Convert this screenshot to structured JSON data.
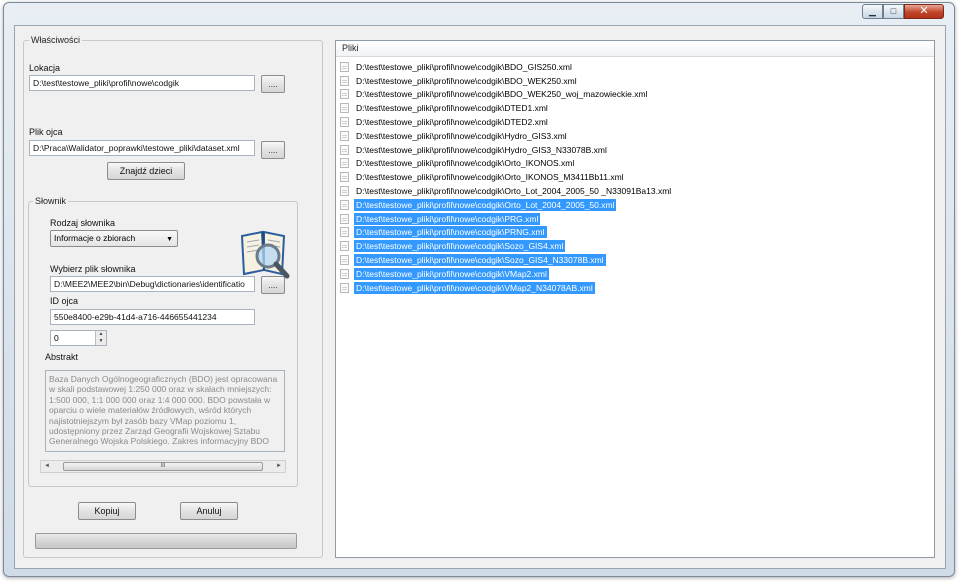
{
  "window": {
    "buttons": {
      "minimize": "▁",
      "maximize": "□",
      "close": "✕"
    }
  },
  "properties": {
    "title": "Właściwości",
    "location": {
      "label": "Lokacja",
      "value": "D:\\test\\testowe_pliki\\profil\\nowe\\codgik",
      "browse": "...."
    },
    "parent_file": {
      "label": "Plik ojca",
      "value": "D:\\Praca\\Walidator_poprawki\\testowe_pliki\\dataset.xml",
      "browse": "...."
    },
    "find_children": "Znajdź dzieci",
    "dictionary": {
      "title": "Słownik",
      "type_label": "Rodzaj słownika",
      "type_value": "Informacje o zbiorach",
      "file_label": "Wybierz plik słownika",
      "file_value": "D:\\MEE2\\MEE2\\bin\\Debug\\dictionaries\\identificatio",
      "browse": "....",
      "id_label": "ID ojca",
      "id_value": "550e8400-e29b-41d4-a716-446655441234",
      "spinner_value": "0",
      "abstract_label": "Abstrakt",
      "abstract_text": "Baza Danych Ogólnogeograficznych (BDO) jest opracowana w skali podstawowej 1:250 000 oraz w skalach mniejszych: 1:500 000, 1:1 000 000 oraz 1:4 000 000. BDO powstała w oparciu o wiele materiałów źródłowych, wśród których najistotniejszym był zasób bazy VMap poziomu 1, udostępniony przez Zarząd Geografii Wojskowej Sztabu Generalnego Wojska Polskiego. Zakres informacyjny BDO",
      "scroll_thumb": "III"
    },
    "copy": "Kopiuj",
    "cancel": "Anuluj",
    "progress": 0
  },
  "files": {
    "header": "Pliki",
    "items": [
      {
        "path": "D:\\test\\testowe_pliki\\profil\\nowe\\codgik\\BDO_GIS250.xml",
        "selected": false
      },
      {
        "path": "D:\\test\\testowe_pliki\\profil\\nowe\\codgik\\BDO_WEK250.xml",
        "selected": false
      },
      {
        "path": "D:\\test\\testowe_pliki\\profil\\nowe\\codgik\\BDO_WEK250_woj_mazowieckie.xml",
        "selected": false
      },
      {
        "path": "D:\\test\\testowe_pliki\\profil\\nowe\\codgik\\DTED1.xml",
        "selected": false
      },
      {
        "path": "D:\\test\\testowe_pliki\\profil\\nowe\\codgik\\DTED2.xml",
        "selected": false
      },
      {
        "path": "D:\\test\\testowe_pliki\\profil\\nowe\\codgik\\Hydro_GIS3.xml",
        "selected": false
      },
      {
        "path": "D:\\test\\testowe_pliki\\profil\\nowe\\codgik\\Hydro_GIS3_N33078B.xml",
        "selected": false
      },
      {
        "path": "D:\\test\\testowe_pliki\\profil\\nowe\\codgik\\Orto_IKONOS.xml",
        "selected": false
      },
      {
        "path": "D:\\test\\testowe_pliki\\profil\\nowe\\codgik\\Orto_IKONOS_M3411Bb11.xml",
        "selected": false
      },
      {
        "path": "D:\\test\\testowe_pliki\\profil\\nowe\\codgik\\Orto_Lot_2004_2005_50 _N33091Ba13.xml",
        "selected": false
      },
      {
        "path": "D:\\test\\testowe_pliki\\profil\\nowe\\codgik\\Orto_Lot_2004_2005_50.xml",
        "selected": true
      },
      {
        "path": "D:\\test\\testowe_pliki\\profil\\nowe\\codgik\\PRG.xml",
        "selected": true
      },
      {
        "path": "D:\\test\\testowe_pliki\\profil\\nowe\\codgik\\PRNG.xml",
        "selected": true
      },
      {
        "path": "D:\\test\\testowe_pliki\\profil\\nowe\\codgik\\Sozo_GIS4.xml",
        "selected": true
      },
      {
        "path": "D:\\test\\testowe_pliki\\profil\\nowe\\codgik\\Sozo_GIS4_N33078B.xml",
        "selected": true
      },
      {
        "path": "D:\\test\\testowe_pliki\\profil\\nowe\\codgik\\VMap2.xml",
        "selected": true
      },
      {
        "path": "D:\\test\\testowe_pliki\\profil\\nowe\\codgik\\VMap2_N34078AB.xml",
        "selected": true
      }
    ]
  },
  "colors": {
    "selection": "#3399ff",
    "close_button": "#c1452a"
  }
}
